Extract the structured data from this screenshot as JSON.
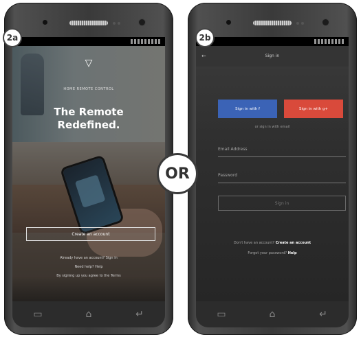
{
  "badges": {
    "a": "2a",
    "b": "2b",
    "or": "OR"
  },
  "screen_a": {
    "logo": "▽",
    "tagline": "HOME REMOTE CONTROL",
    "headline_line1": "The Remote",
    "headline_line2": "Redefined.",
    "create_button": "Create an account",
    "line1": "Already have an account?   Sign in",
    "line2": "Need help?   Help",
    "line3": "By signing up you agree to the Terms"
  },
  "screen_b": {
    "back_icon": "←",
    "title": "Sign in",
    "facebook_button": "Sign in with f",
    "google_button": "Sign in with g+",
    "or_text": "or sign in with email",
    "email_placeholder": "Email Address",
    "password_placeholder": "Password",
    "signin_button": "Sign in",
    "footer_line1": "Don't have an account?",
    "footer_line1_link": "Create an account",
    "footer_line2": "Forgot your password?",
    "footer_line2_link": "Help"
  },
  "navbar": {
    "recents_icon": "▭",
    "home_icon": "⌂",
    "back_icon": "↵"
  }
}
